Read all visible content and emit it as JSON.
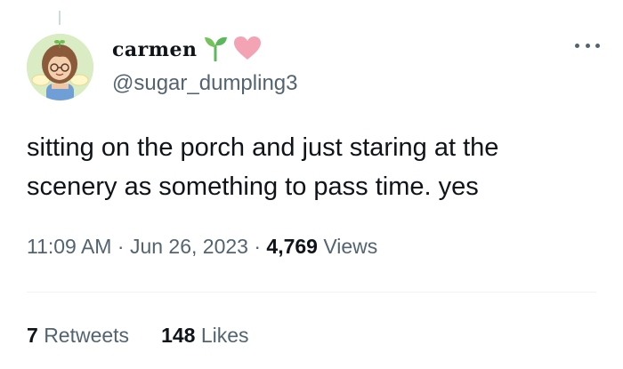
{
  "user": {
    "display_name": "carmen",
    "handle": "@sugar_dumpling3",
    "emojis": [
      "seedling-icon",
      "pink-heart-icon"
    ]
  },
  "tweet": {
    "text_line_1": "sitting on the porch and just staring at the",
    "text_line_2": "scenery as something to pass time. yes"
  },
  "meta": {
    "time": "11:09 AM",
    "separator": "·",
    "date": "Jun 26, 2023",
    "views_count": "4,769",
    "views_label": "Views"
  },
  "stats": {
    "retweets_count": "7",
    "retweets_label": "Retweets",
    "likes_count": "148",
    "likes_label": "Likes"
  },
  "colors": {
    "text_primary": "#0f1419",
    "text_secondary": "#536471",
    "divider": "#eff3f4",
    "seedling": "#5cb85c",
    "heart": "#f4a3b4"
  }
}
